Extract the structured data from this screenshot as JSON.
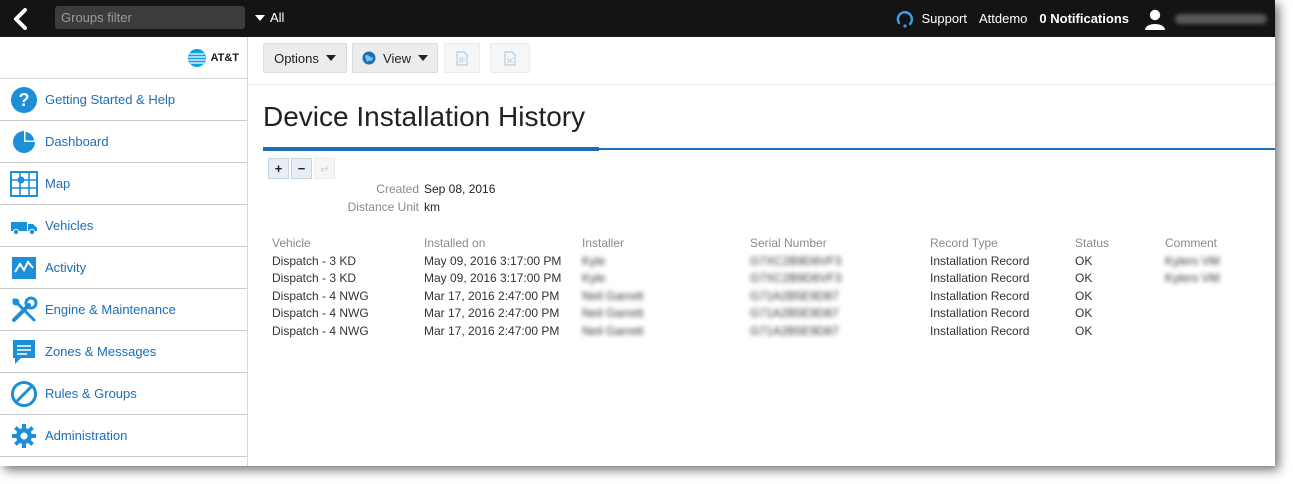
{
  "topbar": {
    "groups_filter_placeholder": "Groups filter",
    "group_scope": "All",
    "support_label": "Support",
    "account_label": "Attdemo",
    "notifications_label": "0 Notifications"
  },
  "sidebar": {
    "brand": "AT&T",
    "items": [
      {
        "label": "Getting Started & Help",
        "icon": "help-circle-icon"
      },
      {
        "label": "Dashboard",
        "icon": "pie-chart-icon"
      },
      {
        "label": "Map",
        "icon": "map-icon"
      },
      {
        "label": "Vehicles",
        "icon": "truck-icon"
      },
      {
        "label": "Activity",
        "icon": "activity-chart-icon"
      },
      {
        "label": "Engine & Maintenance",
        "icon": "wrench-icon"
      },
      {
        "label": "Zones & Messages",
        "icon": "message-icon"
      },
      {
        "label": "Rules & Groups",
        "icon": "no-entry-icon"
      },
      {
        "label": "Administration",
        "icon": "gear-icon"
      }
    ]
  },
  "toolbar": {
    "options_label": "Options",
    "view_label": "View"
  },
  "page": {
    "title": "Device Installation History"
  },
  "meta": {
    "created_label": "Created",
    "created_value": "Sep 08, 2016",
    "unit_label": "Distance Unit",
    "unit_value": "km"
  },
  "table": {
    "columns": [
      "Vehicle",
      "Installed on",
      "Installer",
      "Serial Number",
      "Record Type",
      "Status",
      "Comment"
    ],
    "rows": [
      [
        "Dispatch - 3 KD",
        "May 09, 2016 3:17:00 PM",
        "Kyle",
        "G7XC2B9D6VF3",
        "Installation Record",
        "OK",
        "Kylers VM"
      ],
      [
        "Dispatch - 3 KD",
        "May 09, 2016 3:17:00 PM",
        "Kyle",
        "G7XC2B9D6VF3",
        "Installation Record",
        "OK",
        "Kylers VM"
      ],
      [
        "Dispatch - 4 NWG",
        "Mar 17, 2016 2:47:00 PM",
        "Neil Garrett",
        "G71A2B5E9D87",
        "Installation Record",
        "OK",
        ""
      ],
      [
        "Dispatch - 4 NWG",
        "Mar 17, 2016 2:47:00 PM",
        "Neil Garrett",
        "G71A2B5E9D87",
        "Installation Record",
        "OK",
        ""
      ],
      [
        "Dispatch - 4 NWG",
        "Mar 17, 2016 2:47:00 PM",
        "Neil Garrett",
        "G71A2B5E9D87",
        "Installation Record",
        "OK",
        ""
      ]
    ]
  },
  "colors": {
    "accent": "#1b6eb8",
    "topbar_bg": "#141414"
  }
}
